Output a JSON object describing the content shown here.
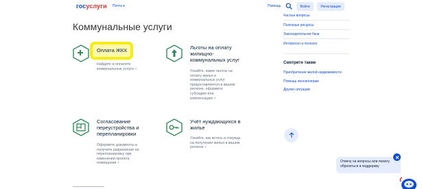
{
  "header": {
    "logo_part1": "гос",
    "logo_part2": "услуги",
    "city": "Почта",
    "help": "Помощь",
    "login": "Войти",
    "register": "Регистрация"
  },
  "page": {
    "title": "Коммунальные услуги"
  },
  "cards": [
    {
      "title": "Оплата ЖКХ",
      "desc": "Найдите и оплатите коммунальные услуги",
      "icon": "faucet-icon"
    },
    {
      "title": "Льготы на оплату жилищно-коммунальных услуг",
      "desc": "Узнайте, какие льготы на оплату жилья и коммунальных услуг предоставляются в вашем регионе, оформите субсидию или компенсацию",
      "icon": "benefits-icon"
    },
    {
      "title": "Согласование переустройства и перепланировки",
      "desc": "Оформите документы и получите разрешение на перепланировку при изменении проекта помещения",
      "icon": "floorplan-icon"
    },
    {
      "title": "Учёт нуждающихся в жилье",
      "desc": "Узнайте, как встать в очередь на получение жилья в вашем регионе",
      "icon": "key-icon"
    }
  ],
  "sidebar": {
    "links_top": [
      "Частые вопросы",
      "Полезные ресурсы",
      "Законодательная база",
      "Интересно и полезно"
    ],
    "see_also_title": "Смотрите также",
    "see_also": [
      "Приобретение жилой недвижимости",
      "Помощь пенсионерам",
      "Другие ситуации"
    ]
  },
  "chat": {
    "text": "Отвечу на вопросы или помогу обратиться в поддержку"
  },
  "colors": {
    "brand_blue": "#0d4cd3",
    "brand_red": "#e52e2e",
    "icon_green": "#2e8b57",
    "highlight": "#f5ec00"
  }
}
